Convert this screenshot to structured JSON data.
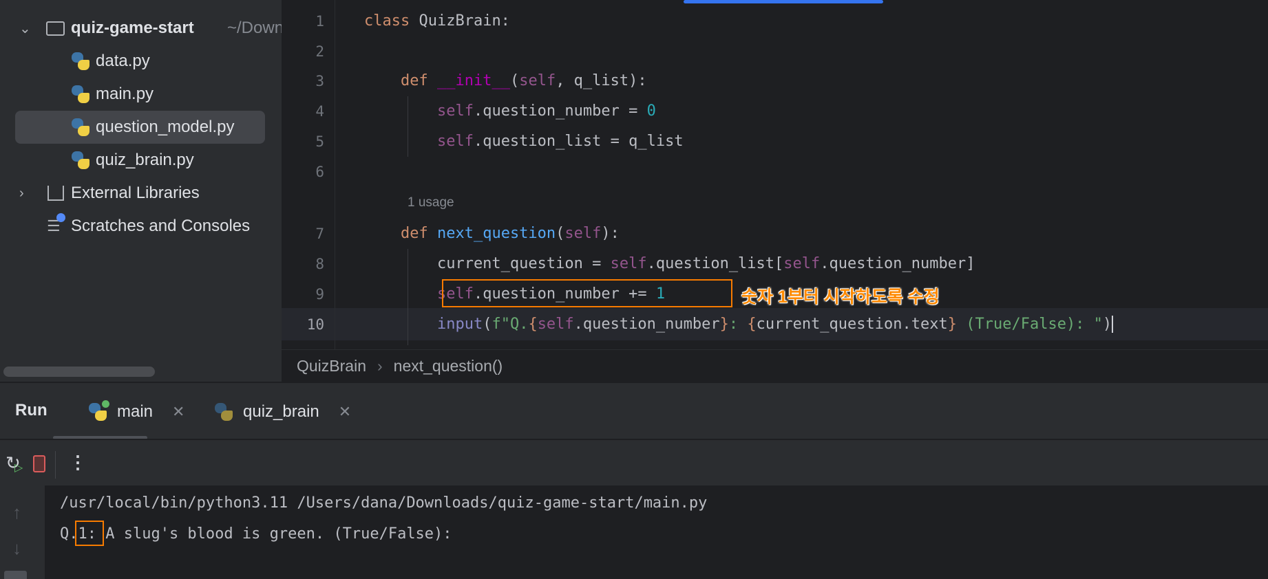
{
  "project": {
    "root": "quiz-game-start",
    "root_path": "~/Down",
    "files": [
      "data.py",
      "main.py",
      "question_model.py",
      "quiz_brain.py"
    ],
    "selected": "question_model.py",
    "external": "External Libraries",
    "scratches": "Scratches and Consoles"
  },
  "editor": {
    "line_numbers": [
      "1",
      "2",
      "3",
      "4",
      "5",
      "6",
      "7",
      "8",
      "9",
      "10"
    ],
    "usage_hint": "1 usage",
    "current_line": 10
  },
  "annotation": "숫자 1부터 시작하도록 수정",
  "breadcrumb": [
    "QuizBrain",
    "next_question()"
  ],
  "run": {
    "title": "Run",
    "tabs": [
      "main",
      "quiz_brain"
    ],
    "active_tab": "main"
  },
  "console": {
    "lines": [
      "/usr/local/bin/python3.11 /Users/dana/Downloads/quiz-game-start/main.py",
      "Q.1: A slug's blood is green. (True/False): "
    ]
  },
  "colors": {
    "accent": "#3574f0",
    "highlight_box": "#f77b00"
  }
}
